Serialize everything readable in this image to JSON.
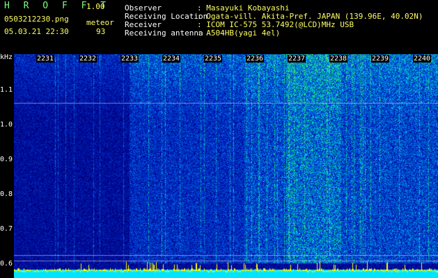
{
  "header": {
    "brand": "H R O F F T",
    "version": "1.00",
    "filename": "0503212230.png",
    "mode": "meteor",
    "datetime": "05.03.21 22:30",
    "count": "93",
    "observer_label": "Observer",
    "observer_value": ": Masayuki Kobayashi",
    "location_label": "Receiving Location",
    "location_value": ": Ogata-vill. Akita-Pref. JAPAN (139.96E, 40.02N)",
    "receiver_label": "Receiver",
    "receiver_value": ": ICOM IC-575 53.7492(@LCD)MHz USB",
    "antenna_label": "Receiving antenna",
    "antenna_value": ": A504HB(yagi 4el)"
  },
  "spectrogram": {
    "y_unit": "kHz",
    "y_ticks": [
      "1.1",
      "1.0",
      "0.9",
      "0.8",
      "0.7",
      "0.6"
    ],
    "x_ticks": [
      "2231",
      "2232",
      "2233",
      "2234",
      "2235",
      "2236",
      "2237",
      "2238",
      "2239",
      "2240"
    ]
  }
}
